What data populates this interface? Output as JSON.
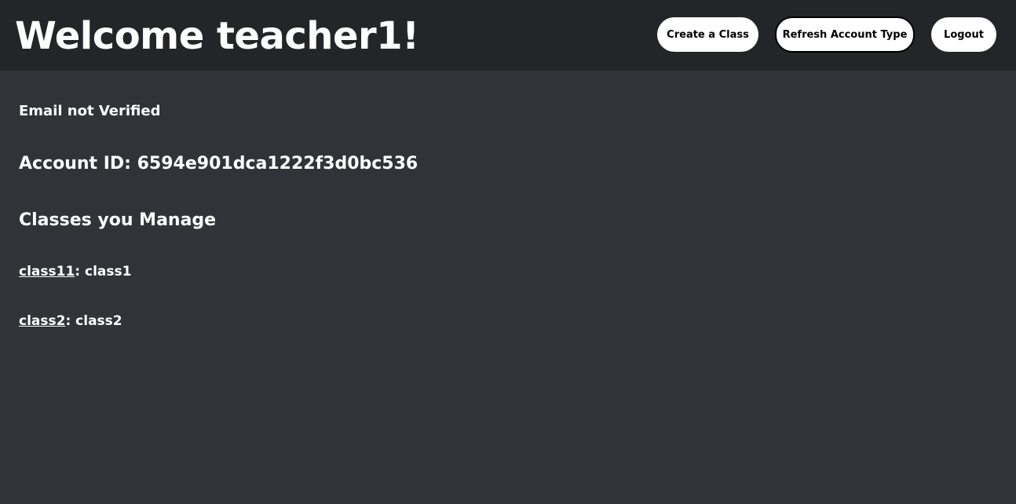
{
  "header": {
    "title": "Welcome teacher1!",
    "buttons": {
      "create_class": "Create a Class",
      "refresh_account_type": "Refresh Account Type",
      "logout": "Logout"
    }
  },
  "main": {
    "email_status": "Email not Verified",
    "account_id": "Account ID: 6594e901dca1222f3d0bc536",
    "classes_heading": "Classes you Manage",
    "classes": [
      {
        "id": "class11",
        "name": "class1"
      },
      {
        "id": "class2",
        "name": "class2"
      }
    ]
  },
  "colors": {
    "header_bg": "#232529",
    "page_bg": "#313338",
    "text": "#ffffff",
    "button_bg": "#ffffff"
  }
}
